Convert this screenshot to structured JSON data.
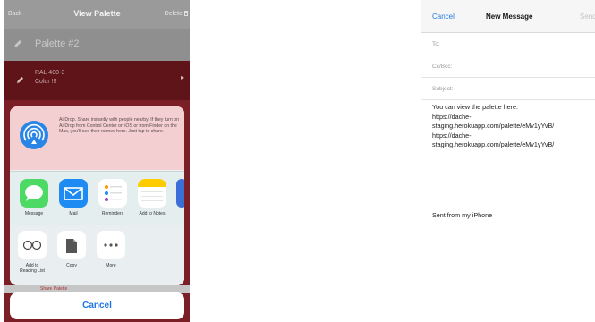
{
  "left": {
    "navbar": {
      "back": "Back",
      "title": "View Palette",
      "delete": "Delete"
    },
    "palette_name": "Palette #2",
    "color_row": {
      "code": "RAL 400-3",
      "label": "Color !!!"
    },
    "airdrop": {
      "text": "AirDrop. Share instantly with people nearby. If they turn on AirDrop from Control Center on iOS or from Finder on the Mac, you'll see their names here. Just tap to share."
    },
    "apps": [
      {
        "label": "Message",
        "icon": "message-icon",
        "color": "#4cd964"
      },
      {
        "label": "Mail",
        "icon": "mail-icon",
        "color": "#1d8bf1"
      },
      {
        "label": "Reminders",
        "icon": "reminders-icon",
        "color": "#ffffff"
      },
      {
        "label": "Add to Notes",
        "icon": "notes-icon",
        "color": "#ffffff"
      }
    ],
    "actions": [
      {
        "label": "Add to Reading List",
        "icon": "reading-glasses-icon"
      },
      {
        "label": "Copy",
        "icon": "copy-icon"
      },
      {
        "label": "More",
        "icon": "more-icon"
      }
    ],
    "footer_strip": "Share Palette",
    "cancel": "Cancel"
  },
  "right": {
    "navbar": {
      "cancel": "Cancel",
      "title": "New Message",
      "send": "Send"
    },
    "fields": {
      "to": "To:",
      "cc": "Cc/Bcc:",
      "subject": "Subject:"
    },
    "body_lines": [
      "You can view the palette here:",
      "https://dache-",
      "staging.herokuapp.com/palette/eMv1yYvB/",
      "https://dache-",
      "staging.herokuapp.com/palette/eMv1yYvB/"
    ],
    "signature": "Sent from my iPhone"
  },
  "colors": {
    "accent_blue": "#1c74e6",
    "maroon": "#5e1419",
    "airdrop_bg": "#f3cfd1"
  }
}
